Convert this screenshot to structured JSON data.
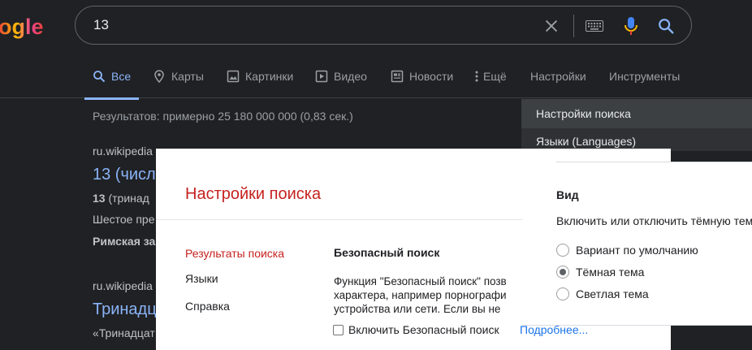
{
  "logo": {
    "partial_text": "ogle"
  },
  "search": {
    "value": "13"
  },
  "icons": {
    "clear": "close-icon",
    "keyboard": "keyboard-icon",
    "mic": "mic-icon",
    "search": "search-icon"
  },
  "tabs": [
    {
      "label": "Все",
      "icon": "search-icon",
      "active": true
    },
    {
      "label": "Карты",
      "icon": "map-pin-icon"
    },
    {
      "label": "Картинки",
      "icon": "image-icon"
    },
    {
      "label": "Видео",
      "icon": "play-icon"
    },
    {
      "label": "Новости",
      "icon": "news-icon"
    },
    {
      "label": "Ещё",
      "icon": "more-vert-icon"
    },
    {
      "label": "Настройки"
    },
    {
      "label": "Инструменты"
    }
  ],
  "stats": "Результатов: примерно 25 180 000 000 (0,83 сек.)",
  "results": [
    {
      "url": "ru.wikipedia",
      "title": "13 (числ",
      "line1_bold": "13",
      "line1": " (тринад",
      "line2": "Шестое пре",
      "line3": "Римская за"
    },
    {
      "url": "ru.wikipedia",
      "title": "Тринадц",
      "line1": "«Тринадцат"
    }
  ],
  "dropdown": {
    "items": [
      "Настройки поиска",
      "Языки (Languages)"
    ]
  },
  "modal": {
    "title": "Настройки поиска",
    "sidebar": [
      "Результаты поиска",
      "Языки",
      "Справка"
    ],
    "safe_search": {
      "heading": "Безопасный поиск",
      "text": "Функция \"Безопасный поиск\" позв\nхарактера, например порнографи\nустройства или сети. Если вы не",
      "checkbox_label": "Включить Безопасный поиск",
      "more_link": "Подробнее..."
    }
  },
  "view": {
    "heading": "Вид",
    "desc": "Включить или отключить тёмную тем",
    "options": [
      "Вариант по умолчанию",
      "Тёмная тема",
      "Светлая тема"
    ],
    "selected": "Тёмная тема"
  },
  "colors": {
    "background": "#202124",
    "link": "#8ab4f8",
    "modal_accent": "#c5221f",
    "mic_blue": "#4285f4",
    "mic_red": "#ea4335"
  }
}
